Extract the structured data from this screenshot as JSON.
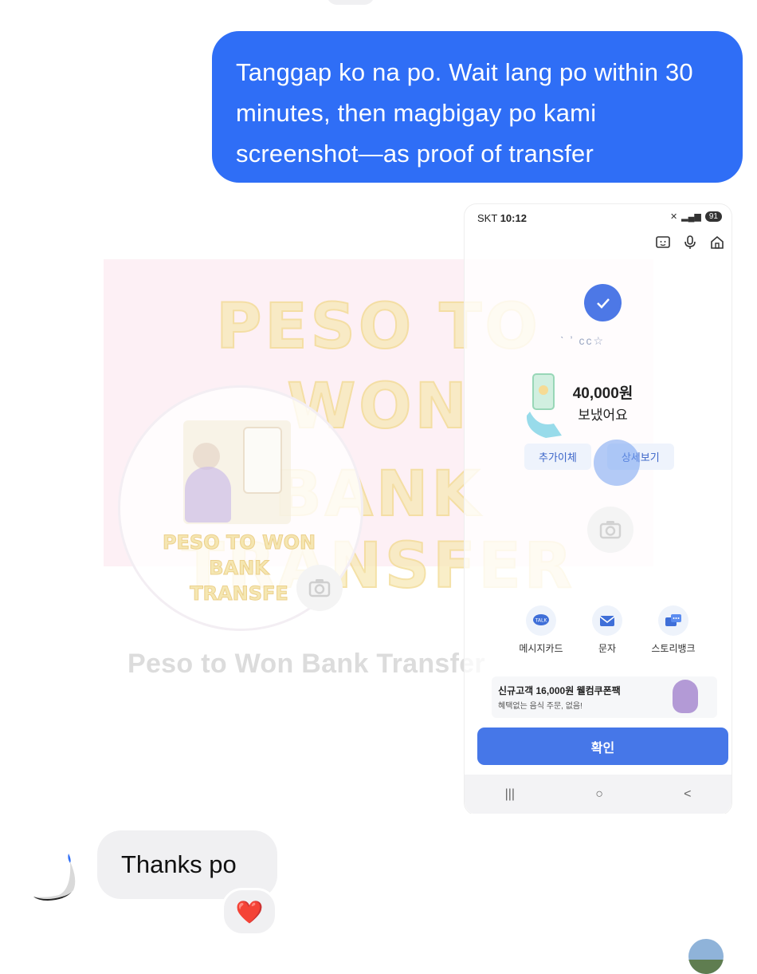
{
  "conversation": {
    "outgoing_message": "Tanggap ko na po. Wait lang po within 30 minutes, then magbigay po kami screenshot—as proof of transfer",
    "incoming_message": "Thanks po",
    "reaction": "❤️"
  },
  "watermark": {
    "line1": "PESO TO",
    "line2": "WON",
    "line3": "BANK TRANSFER",
    "circle_line1": "PESO TO WON",
    "circle_line2": "BANK",
    "circle_line3": "TRANSFE",
    "brand_name": "Peso to Won Bank Transfer"
  },
  "phone": {
    "carrier": "SKT",
    "time": "10:12",
    "battery": "91",
    "recipient_partial": "ˋ    ʼ          ᴄᴄ☆",
    "amount": "40,000원",
    "sent_label": "보냈어요",
    "buttons": {
      "add_transfer": "추가이체",
      "details": "상세보기"
    },
    "share_items": [
      {
        "label": "메시지카드",
        "icon": "talk-icon"
      },
      {
        "label": "문자",
        "icon": "mail-icon"
      },
      {
        "label": "스토리뱅크",
        "icon": "chat-bubbles-icon"
      }
    ],
    "promo": {
      "title": "신규고객 16,000원 웰컴쿠폰팩",
      "subtitle": "혜택없는 음식 주문, 없음!"
    },
    "confirm_label": "확인",
    "nav": {
      "recents": "|||",
      "home": "○",
      "back": "<"
    }
  },
  "colors": {
    "outgoing_bubble": "#2f6ef6",
    "incoming_bubble": "#f0f0f2",
    "confirm_button": "#4677e8"
  }
}
